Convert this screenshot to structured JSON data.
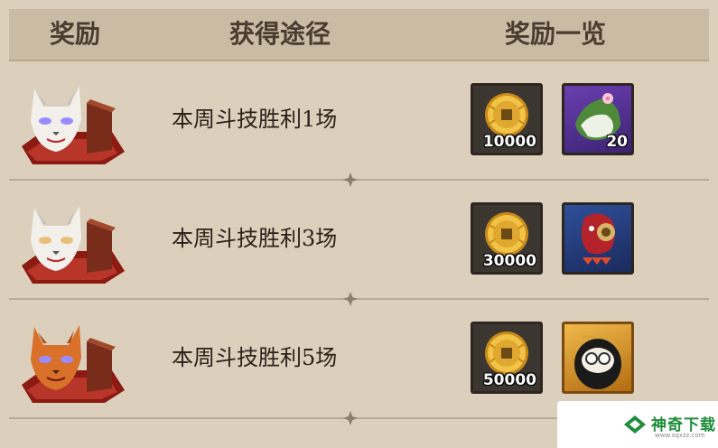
{
  "header": {
    "reward": "奖励",
    "route": "获得途径",
    "list": "奖励一览"
  },
  "rows": [
    {
      "mask_icon": "white-cat-mask-chest-icon",
      "route": "本周斗技胜利1场",
      "coin": "10000",
      "item_icon": "rice-dumpling-icon",
      "item_count": "20"
    },
    {
      "mask_icon": "white-cat-mask-chest-icon",
      "route": "本周斗技胜利3场",
      "coin": "30000",
      "item_icon": "red-shikigami-icon",
      "item_count": ""
    },
    {
      "mask_icon": "orange-cat-mask-chest-icon",
      "route": "本周斗技胜利5场",
      "coin": "50000",
      "item_icon": "daruma-icon",
      "item_count": ""
    }
  ],
  "watermark": {
    "brand": "神奇下载",
    "url": "www.sqxzz.com"
  },
  "colors": {
    "background": "#dcd0bd",
    "header": "#c9bba4",
    "text": "#2b2119",
    "watermark_green": "#1c8d3a"
  }
}
